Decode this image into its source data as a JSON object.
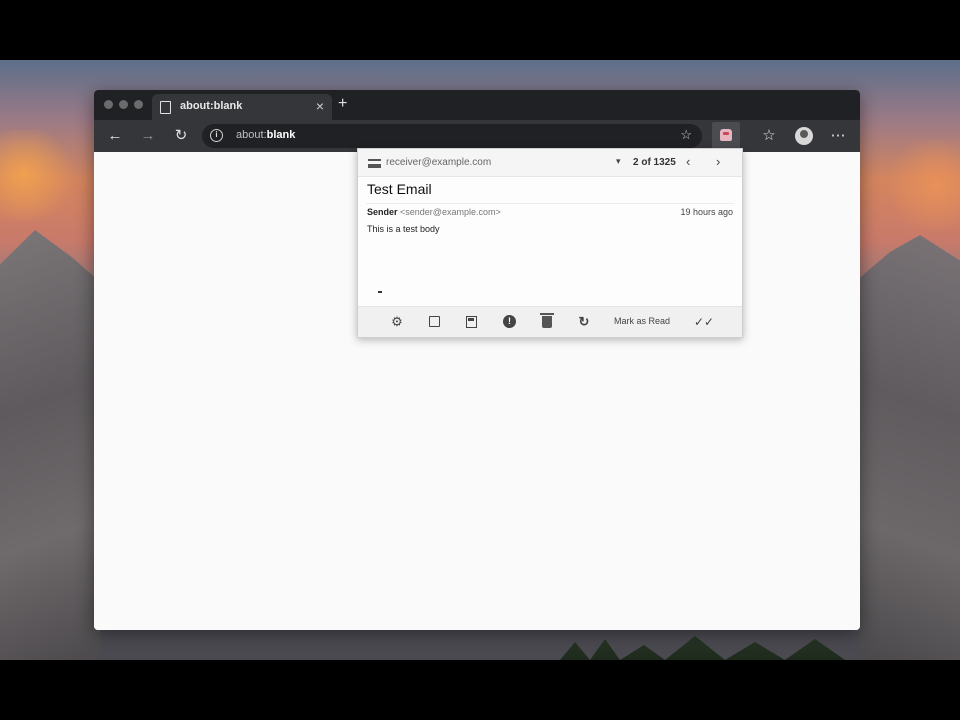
{
  "browser": {
    "tab_title": "about:blank",
    "tab_close": "×",
    "new_tab": "+",
    "url_scheme": "about:",
    "url_host": "blank",
    "back": "←",
    "forward": "→",
    "reload": "↻",
    "info": "i",
    "star": "☆",
    "bookmarks": "☆",
    "menu": "⋯"
  },
  "popup": {
    "account": "receiver@example.com",
    "caret": "▾",
    "counter": "2 of 1325",
    "prev": "‹",
    "next": "›",
    "subject": "Test Email",
    "sender_name": "Sender",
    "sender_email": "<sender@example.com>",
    "received": "19 hours ago",
    "body": "This is a test body",
    "actions": {
      "settings": "⚙",
      "spam": "!",
      "refresh": "↻",
      "mark_read": "Mark as Read",
      "mark_all": "✓✓"
    }
  }
}
